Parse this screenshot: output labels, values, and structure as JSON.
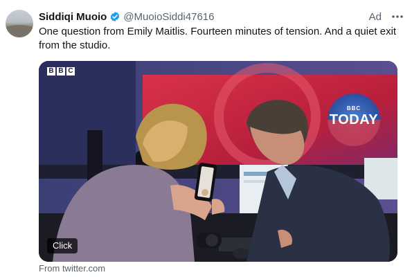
{
  "author": {
    "name": "Siddiqi Muoio",
    "handle": "@MuoioSiddi47616",
    "verified_color": "#1d9bf0",
    "avatar_icon": "landscape-avatar"
  },
  "meta": {
    "ad_label": "Ad",
    "more_icon": "ellipsis-icon"
  },
  "tweet_text": "One question from Emily Maitlis. Fourteen minutes of tension. And a quiet exit from the studio.",
  "media": {
    "channel_logo_letters": [
      "B",
      "B",
      "C"
    ],
    "badge_small": "BBC",
    "badge_big": "TODAY",
    "click_label": "Click"
  },
  "footer": {
    "source": "From twitter.com"
  },
  "colors": {
    "text": "#0f1419",
    "secondary": "#536471",
    "studio_bg": "#2a2e55",
    "screen_red": "#c9263d"
  }
}
